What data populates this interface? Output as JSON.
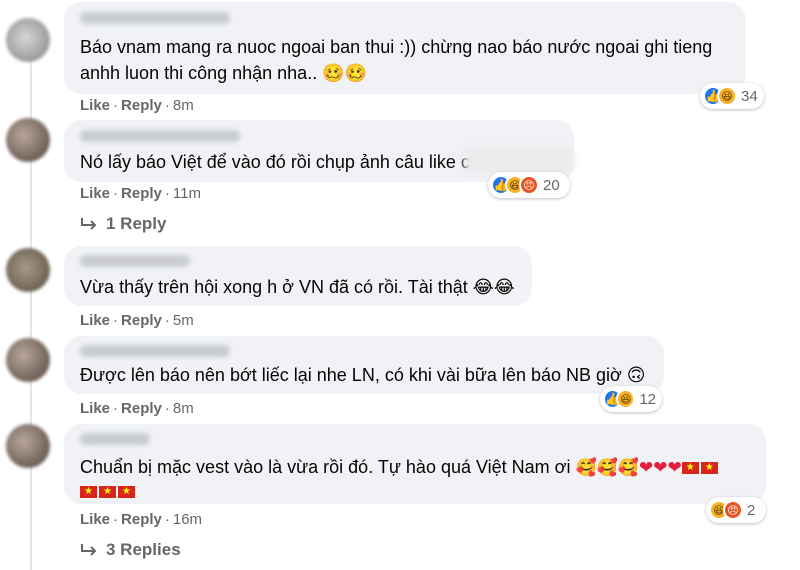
{
  "comments": [
    {
      "text_lines": [
        "Báo vnam mang ra nuoc ngoai ban thui :)) chừng nao báo nước ngoai ghi tieng",
        "anhh luon thi công nhận nha.. 🥴🥴"
      ],
      "like": "Like",
      "reply": "Reply",
      "time": "8m",
      "reaction_count": "34",
      "reaction_icons": [
        "like-icon",
        "haha-icon"
      ]
    },
    {
      "text_lines": [
        "Nó lấy báo Việt để vào đó rồi chụp ảnh câu like c"
      ],
      "like": "Like",
      "reply": "Reply",
      "time": "11m",
      "reaction_count": "20",
      "reaction_icons": [
        "like-icon",
        "haha-icon",
        "angry-icon"
      ],
      "replies_label": "1 Reply"
    },
    {
      "text_lines": [
        "Vừa thấy trên hội xong h ở VN đã có rồi. Tài thật 😂😂"
      ],
      "like": "Like",
      "reply": "Reply",
      "time": "5m"
    },
    {
      "text_lines": [
        "Được lên báo nên bớt liếc lại nhe LN, có khi vài bữa lên báo NB giờ 🙃"
      ],
      "like": "Like",
      "reply": "Reply",
      "time": "8m",
      "reaction_count": "12",
      "reaction_icons": [
        "like-icon",
        "haha-icon"
      ]
    },
    {
      "text_lines": [
        "Chuẩn bị mặc vest vào là vừa rồi đó. Tự hào quá Việt Nam ơi"
      ],
      "like": "Like",
      "reply": "Reply",
      "time": "16m",
      "reaction_count": "2",
      "reaction_icons": [
        "haha-icon",
        "angry-icon"
      ],
      "replies_label": "3 Replies",
      "emoji_line1": [
        "🥰",
        "🥰",
        "🥰",
        "❤",
        "❤",
        "❤",
        "🇻🇳",
        "🇻🇳"
      ],
      "emoji_line2": [
        "🇻🇳",
        "🇻🇳",
        "🇻🇳"
      ]
    }
  ],
  "colors": {
    "bubble": "#f0f2f5",
    "meta_text": "#65676b",
    "like_blue": "#1877f2",
    "haha_yellow": "#f7b125",
    "angry_orange": "#e8541f"
  }
}
